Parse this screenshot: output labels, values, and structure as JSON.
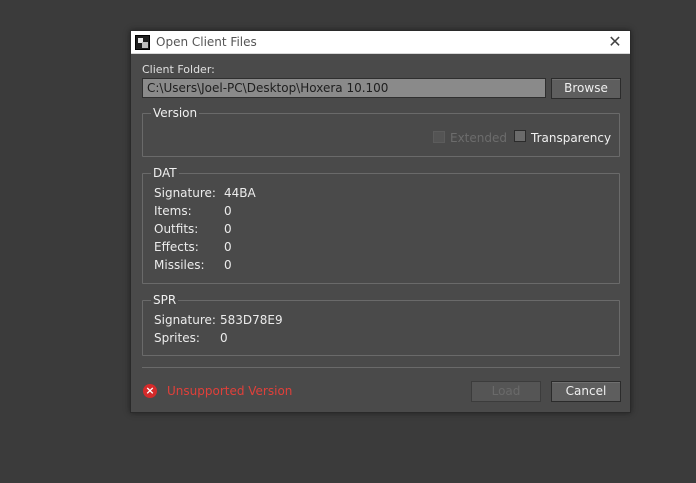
{
  "window": {
    "title": "Open Client Files",
    "close_glyph": "✕"
  },
  "client_folder": {
    "label": "Client Folder:",
    "path": "C:\\Users\\Joel-PC\\Desktop\\Hoxera 10.100",
    "browse_label": "Browse"
  },
  "version": {
    "group_title": "Version",
    "extended_label": "Extended",
    "extended_checked": false,
    "extended_enabled": false,
    "transparency_label": "Transparency",
    "transparency_checked": false
  },
  "dat": {
    "group_title": "DAT",
    "rows": [
      {
        "key": "Signature:",
        "value": "44BA"
      },
      {
        "key": "Items:",
        "value": "0"
      },
      {
        "key": "Outfits:",
        "value": "0"
      },
      {
        "key": "Effects:",
        "value": "0"
      },
      {
        "key": "Missiles:",
        "value": "0"
      }
    ]
  },
  "spr": {
    "group_title": "SPR",
    "rows": [
      {
        "key": "Signature:",
        "value": "583D78E9"
      },
      {
        "key": "Sprites:",
        "value": "0"
      }
    ]
  },
  "status": {
    "icon": "error-icon",
    "text": "Unsupported Version",
    "color": "#e0403a"
  },
  "footer": {
    "load_label": "Load",
    "load_enabled": false,
    "cancel_label": "Cancel"
  }
}
